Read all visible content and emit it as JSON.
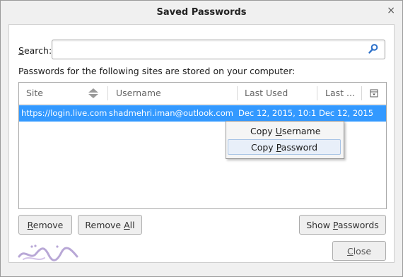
{
  "window": {
    "title": "Saved Passwords",
    "close_glyph": "×"
  },
  "search": {
    "label_key": "S",
    "label_rest": "earch:",
    "value": "",
    "icon": "search-icon"
  },
  "info_text": "Passwords for the following sites are stored on your computer:",
  "table": {
    "columns": [
      "Site",
      "Username",
      "Last Used",
      "Last ..."
    ],
    "sort_icon": "sort-icon",
    "column_picker_icon": "column-picker-icon",
    "rows": [
      {
        "site": "https://login.live.com",
        "username": "shadmehri.iman@outlook.com",
        "last_used": "Dec 12, 2015, 10:13...",
        "last_changed": "Dec 12, 2015",
        "selected": true
      }
    ]
  },
  "context_menu": {
    "items": [
      {
        "pre": "Copy ",
        "key": "U",
        "post": "sername"
      },
      {
        "pre": "Copy ",
        "key": "P",
        "post": "assword"
      }
    ]
  },
  "buttons": {
    "remove": {
      "key": "R",
      "rest": "emove"
    },
    "remove_all": {
      "pre": "Remove ",
      "key": "A",
      "post": "ll"
    },
    "show_passwords": {
      "pre": "Show ",
      "key": "P",
      "post": "asswords"
    },
    "close": {
      "key": "C",
      "rest": "lose"
    }
  },
  "colors": {
    "selection": "#3399ff",
    "accent_icon": "#2a6fc9"
  }
}
